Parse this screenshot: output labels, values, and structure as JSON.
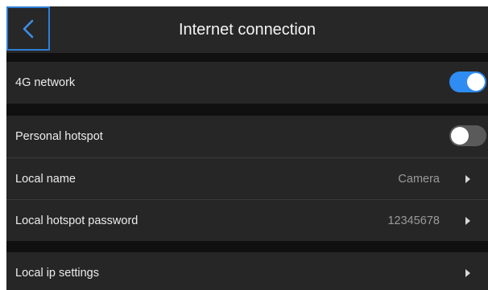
{
  "header": {
    "title": "Internet connection",
    "back_icon": "chevron-left-icon"
  },
  "colors": {
    "accent": "#2f8cf2",
    "toggle_off": "#5a5a5a",
    "row_bg": "#262626",
    "page_bg": "#101010"
  },
  "network": {
    "label": "4G network",
    "enabled": true
  },
  "hotspot": {
    "label": "Personal hotspot",
    "enabled": false,
    "local_name": {
      "label": "Local name",
      "value": "Camera"
    },
    "password": {
      "label": "Local hotspot password",
      "value": "12345678"
    }
  },
  "ip": {
    "label": "Local ip settings"
  }
}
